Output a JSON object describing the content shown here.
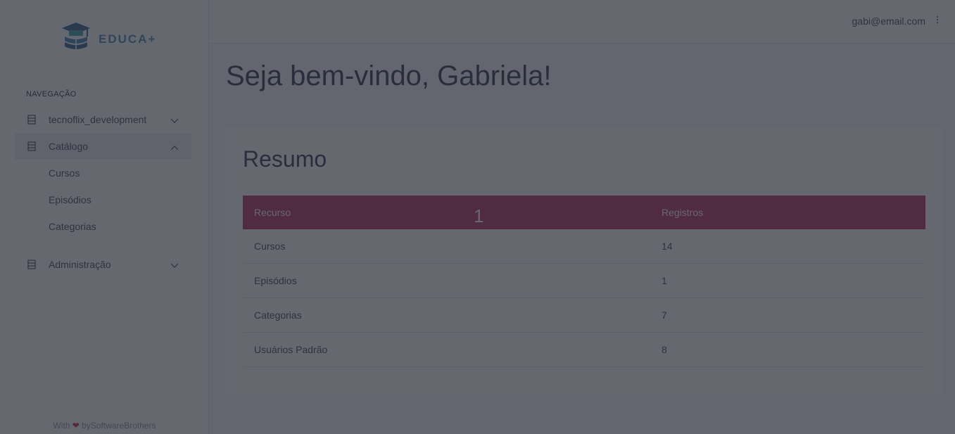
{
  "brand": {
    "name": "EDUCA+"
  },
  "sidebar": {
    "nav_header": "NAVEGAÇÃO",
    "items": [
      {
        "label": "tecnoflix_development"
      },
      {
        "label": "Catálogo"
      },
      {
        "label": "Administração"
      }
    ],
    "catalog_subitems": [
      {
        "label": "Cursos"
      },
      {
        "label": "Episódios"
      },
      {
        "label": "Categorias"
      }
    ],
    "footer": {
      "prefix": "With",
      "suffix": "bySoftwareBrothers"
    }
  },
  "header": {
    "user_email": "gabi@email.com"
  },
  "main": {
    "welcome": "Seja bem-vindo, Gabriela!",
    "summary_title": "Resumo",
    "table": {
      "headers": [
        "Recurso",
        "Registros"
      ],
      "rows": [
        [
          "Cursos",
          "14"
        ],
        [
          "Episódios",
          "1"
        ],
        [
          "Categorias",
          "7"
        ],
        [
          "Usuários Padrão",
          "8"
        ]
      ]
    },
    "marker": "1"
  },
  "colors": {
    "accent": "#b5245a",
    "heart": "#d0103a",
    "logo": "#4a7fb3",
    "overlay": "rgba(42,46,56,0.72)"
  },
  "icons": {
    "nav_item": "database-icon",
    "chevron_down": "chevron-down-icon",
    "chevron_up": "chevron-up-icon",
    "menu": "kebab-menu-icon"
  }
}
